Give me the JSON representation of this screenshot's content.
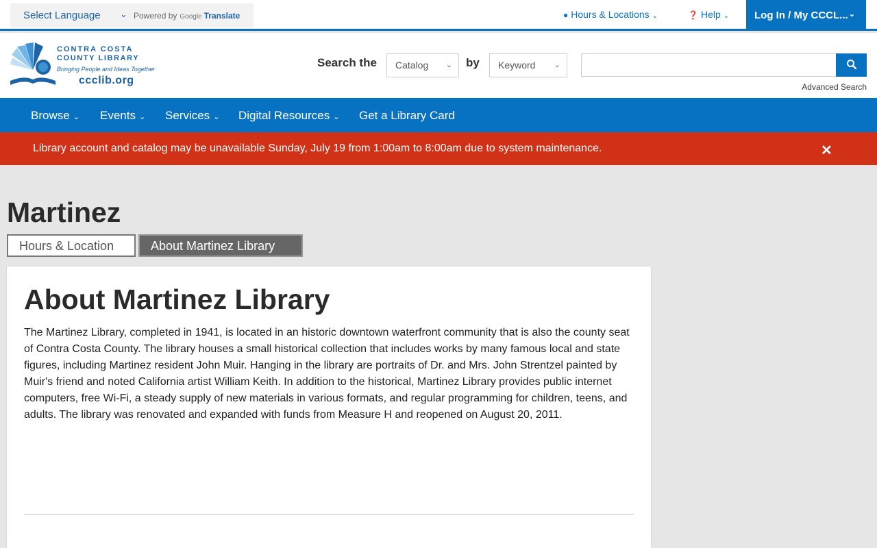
{
  "topbar": {
    "language_label": "Select Language",
    "powered_by": "Powered by",
    "google": "Google",
    "translate": "Translate",
    "hours_locations": "Hours & Locations",
    "help": "Help",
    "login": "Log In / My CCCL..."
  },
  "logo": {
    "line1": "CONTRA COSTA",
    "line2": "COUNTY LIBRARY",
    "tagline": "Bringing People and Ideas Together",
    "url": "ccclib.org"
  },
  "search": {
    "label": "Search the",
    "scope_value": "Catalog",
    "by_label": "by",
    "type_value": "Keyword",
    "query": "",
    "advanced": "Advanced Search"
  },
  "nav": {
    "items": [
      "Browse",
      "Events",
      "Services",
      "Digital Resources",
      "Get a Library Card"
    ]
  },
  "alert": {
    "message": "Library account and catalog may be unavailable Sunday, July 19 from 1:00am to 8:00am due to system maintenance."
  },
  "page": {
    "title": "Martinez",
    "tabs": [
      "Hours & Location",
      "About Martinez Library"
    ],
    "card_title": "About Martinez Library",
    "card_body": "The Martinez Library, completed in 1941, is located in an historic downtown waterfront community that is also the county seat of Contra Costa County. The library houses a small historical collection that includes works by many famous local and state figures, including Martinez resident John Muir. Hanging in the library are portraits of Dr. and Mrs. John Strentzel painted by Muir's friend and noted California artist William Keith. In addition to the historical, Martinez Library provides public internet computers, free Wi-Fi, a steady supply of new materials in various formats, and regular programming for children, teens, and adults. The library was renovated and expanded with funds from Measure H and reopened on August 20, 2011."
  },
  "colors": {
    "brand_blue": "#0872c2",
    "alert_red": "#d13217",
    "active_tab": "#666666"
  }
}
